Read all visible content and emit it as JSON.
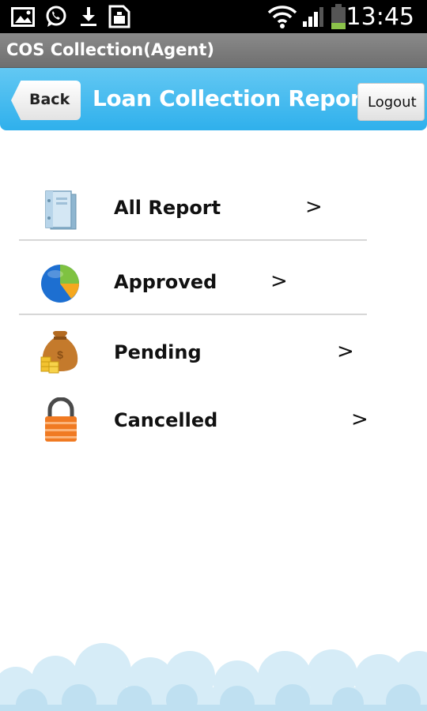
{
  "status_bar": {
    "time": "13:45",
    "icons": [
      "gallery-icon",
      "whatsapp-icon",
      "download-icon",
      "sim-card-icon",
      "wifi-icon",
      "signal-icon",
      "battery-icon"
    ]
  },
  "window": {
    "title": "COS Collection(Agent)"
  },
  "header": {
    "back_label": "Back",
    "title": "Loan Collection Report",
    "logout_label": "Logout",
    "accent_color": "#33b5e5"
  },
  "menu": {
    "items": [
      {
        "label": "All Report",
        "icon": "report-binder-icon",
        "chevron": ">"
      },
      {
        "label": "Approved",
        "icon": "pie-chart-icon",
        "chevron": ">"
      },
      {
        "label": "Pending",
        "icon": "money-bag-icon",
        "chevron": ">"
      },
      {
        "label": "Cancelled",
        "icon": "lock-icon",
        "chevron": ">"
      }
    ]
  }
}
